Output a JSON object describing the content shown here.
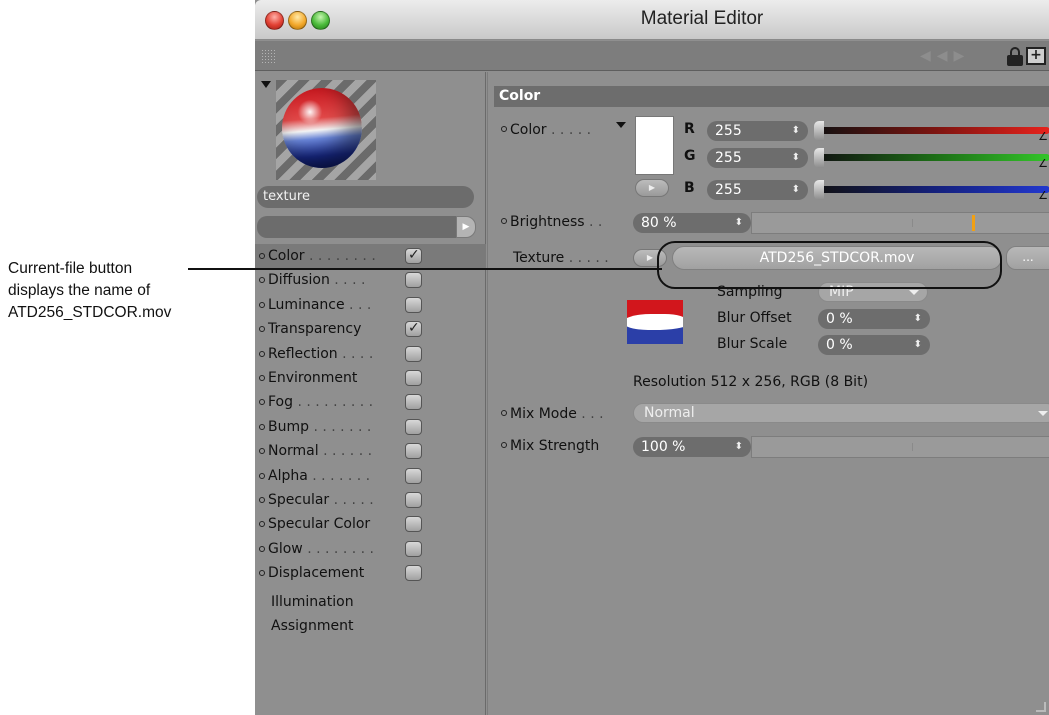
{
  "callout": {
    "lines": [
      "Current-file button",
      "displays the name of",
      "ATD256_STDCOR.mov"
    ]
  },
  "window": {
    "title": "Material Editor"
  },
  "material": {
    "name": "texture"
  },
  "channels": [
    {
      "label": "Color",
      "dots": " . . . . . . . .",
      "checked": true,
      "selected": true
    },
    {
      "label": "Diffusion",
      "dots": " . . . .",
      "checked": false
    },
    {
      "label": "Luminance",
      "dots": " . . .",
      "checked": false
    },
    {
      "label": "Transparency",
      "dots": "",
      "checked": true
    },
    {
      "label": "Reflection",
      "dots": " . . . .",
      "checked": false
    },
    {
      "label": "Environment",
      "dots": "",
      "checked": false
    },
    {
      "label": "Fog",
      "dots": " . . . . . . . . .",
      "checked": false
    },
    {
      "label": "Bump",
      "dots": " . . . . . . .",
      "checked": false
    },
    {
      "label": "Normal",
      "dots": " . . . . . .",
      "checked": false
    },
    {
      "label": "Alpha",
      "dots": " . . . . . . .",
      "checked": false
    },
    {
      "label": "Specular",
      "dots": " . . . . .",
      "checked": false
    },
    {
      "label": "Specular Color",
      "dots": "",
      "checked": false
    },
    {
      "label": "Glow",
      "dots": " . . . . . . . .",
      "checked": false
    },
    {
      "label": "Displacement",
      "dots": "",
      "checked": false
    }
  ],
  "extra_items": [
    "Illumination",
    "Assignment"
  ],
  "color_section": {
    "header": "Color",
    "color_label": "Color",
    "color_dots": " . . . . .",
    "r_label": "R",
    "r_value": "255",
    "g_label": "G",
    "g_value": "255",
    "b_label": "B",
    "b_value": "255",
    "brightness_label": "Brightness",
    "brightness_dots": " . .",
    "brightness_value": "80 %",
    "brightness_fraction": 0.8,
    "texture_label": "Texture",
    "texture_dots": " . . . . .",
    "texture_file": "ATD256_STDCOR.mov",
    "more_label": "...",
    "sampling_label": "Sampling",
    "sampling_value": "MIP",
    "blur_offset_label": "Blur Offset",
    "blur_offset_value": "0 %",
    "blur_scale_label": "Blur Scale",
    "blur_scale_value": "0 %",
    "resolution_info": "Resolution 512 x 256, RGB (8 Bit)",
    "mix_mode_label": "Mix Mode",
    "mix_mode_dots": " . . .",
    "mix_mode_value": "Normal",
    "mix_strength_label": "Mix Strength",
    "mix_strength_value": "100 %"
  },
  "colors": {
    "red": "#e8221c",
    "green": "#33c52a",
    "blue": "#2238cf",
    "brightness_marker": "#f2a013"
  }
}
